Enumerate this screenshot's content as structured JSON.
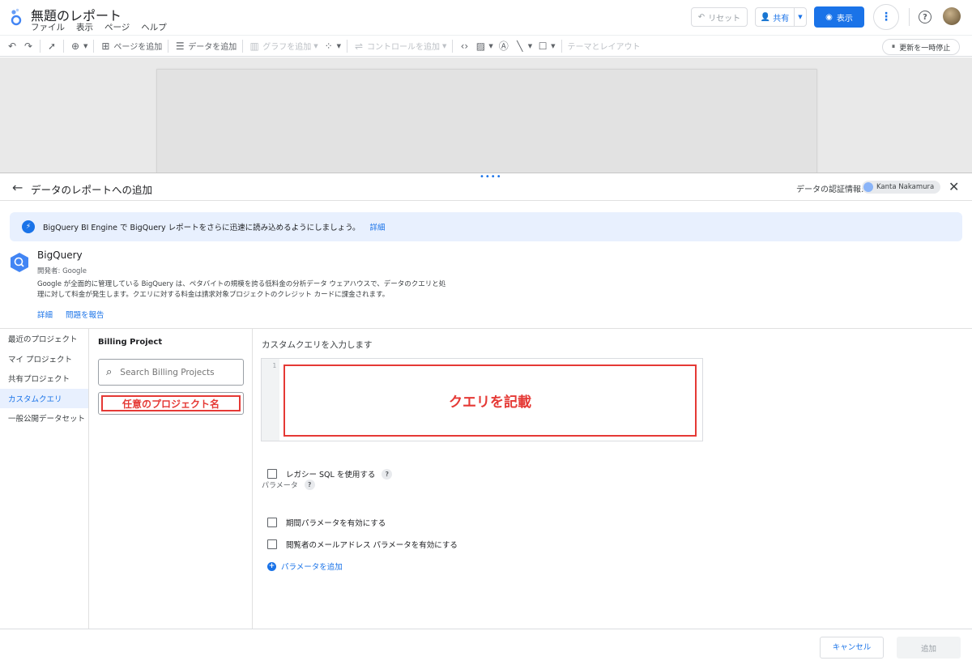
{
  "app": {
    "title": "無題のレポート",
    "menus": [
      "ファイル",
      "表示",
      "ページ",
      "ヘルプ"
    ]
  },
  "header_actions": {
    "reset": "リセット",
    "share": "共有",
    "view": "表示"
  },
  "toolbar": {
    "add_page": "ページを追加",
    "add_data": "データを追加",
    "add_chart": "グラフを追加",
    "add_control": "コントロールを追加",
    "theme_layout": "テーマとレイアウト",
    "pause_updates": "更新を一時停止"
  },
  "panel": {
    "title": "データのレポートへの追加",
    "credentials_label": "データの認証情報:",
    "credentials_user": "Kanta Nakamura"
  },
  "banner": {
    "text": "BigQuery BI Engine で BigQuery レポートをさらに迅速に読み込めるようにしましょう。",
    "link": "詳細"
  },
  "connector": {
    "name": "BigQuery",
    "developer": "開発者: Google",
    "description": "Google が全面的に管理している BigQuery は、ペタバイトの規模を誇る低料金の分析データ ウェアハウスで、データのクエリと処理に対して料金が発生します。クエリに対する料金は請求対象プロジェクトのクレジット カードに課金されます。",
    "links": [
      "詳細",
      "問題を報告"
    ]
  },
  "sidenav": {
    "items": [
      "最近のプロジェクト",
      "マイ プロジェクト",
      "共有プロジェクト",
      "カスタムクエリ",
      "一般公開データセット"
    ],
    "active_index": 3
  },
  "billing": {
    "title": "Billing Project",
    "search_placeholder": "Search Billing Projects",
    "selected_project": "任意のプロジェクト名"
  },
  "query": {
    "title": "カスタムクエリを入力します",
    "line_number": "1",
    "annotation": "クエリを記載",
    "legacy_sql": "レガシー SQL を使用する",
    "parameters_label": "パラメータ",
    "date_range_param": "期間パラメータを有効にする",
    "viewer_email_param": "閲覧者のメールアドレス パラメータを有効にする",
    "add_parameter": "パラメータを追加"
  },
  "footer": {
    "cancel": "キャンセル",
    "add": "追加"
  },
  "colors": {
    "accent": "#1a73e8",
    "annotation_red": "#e53935",
    "banner_bg": "#e8f0fe"
  }
}
